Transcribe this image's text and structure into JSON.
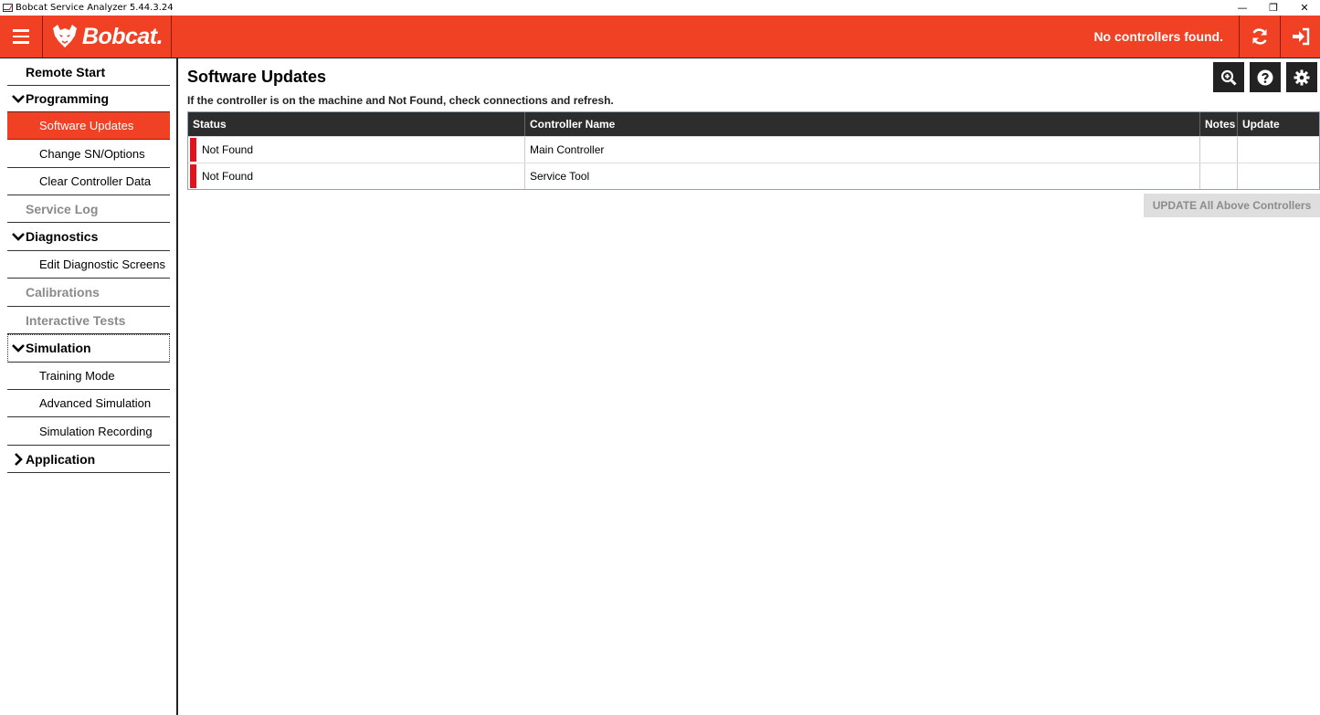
{
  "window": {
    "title": "Bobcat Service Analyzer 5.44.3.24",
    "controls": {
      "minimize": "—",
      "restore": "❐",
      "close": "✕"
    }
  },
  "header": {
    "brand": "Bobcat.",
    "status": "No controllers found.",
    "accent_color": "#f04124"
  },
  "sidebar": {
    "items": [
      {
        "label": "Remote Start",
        "type": "section",
        "state": "enabled"
      },
      {
        "label": "Programming",
        "type": "section",
        "state": "expanded"
      },
      {
        "label": "Software Updates",
        "type": "sub",
        "state": "active"
      },
      {
        "label": "Change SN/Options",
        "type": "sub"
      },
      {
        "label": "Clear Controller Data",
        "type": "sub"
      },
      {
        "label": "Service Log",
        "type": "section",
        "state": "disabled"
      },
      {
        "label": "Diagnostics",
        "type": "section",
        "state": "expanded"
      },
      {
        "label": "Edit Diagnostic Screens",
        "type": "sub"
      },
      {
        "label": "Calibrations",
        "type": "section",
        "state": "disabled"
      },
      {
        "label": "Interactive Tests",
        "type": "section",
        "state": "disabled"
      },
      {
        "label": "Simulation",
        "type": "section",
        "state": "expanded"
      },
      {
        "label": "Training Mode",
        "type": "sub"
      },
      {
        "label": "Advanced Simulation",
        "type": "sub"
      },
      {
        "label": "Simulation Recording",
        "type": "sub"
      },
      {
        "label": "Application",
        "type": "section",
        "state": "collapsed"
      }
    ]
  },
  "main": {
    "title": "Software Updates",
    "hint": "If the controller is on the machine and Not Found, check connections and refresh.",
    "toolbar": [
      "zoom-icon",
      "help-icon",
      "gear-icon"
    ],
    "table": {
      "columns": [
        "Status",
        "Controller Name",
        "Notes",
        "Update"
      ],
      "rows": [
        {
          "status": "Not Found",
          "name": "Main Controller",
          "notes": "",
          "update": ""
        },
        {
          "status": "Not Found",
          "name": "Service Tool",
          "notes": "",
          "update": ""
        }
      ],
      "status_color": "#e2131d"
    },
    "update_all_label": "UPDATE All Above Controllers"
  }
}
